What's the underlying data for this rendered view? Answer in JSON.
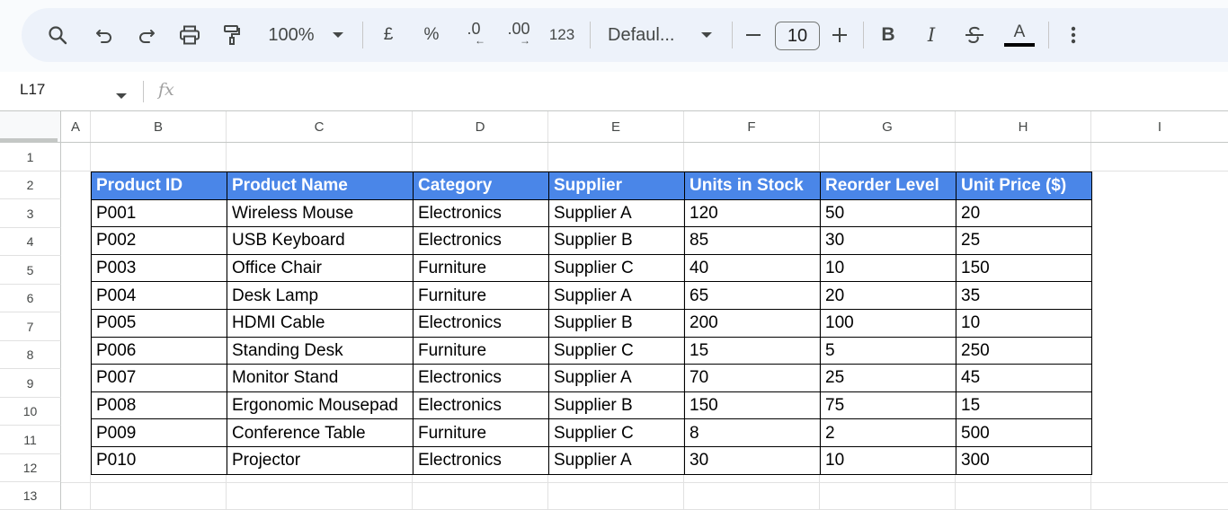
{
  "toolbar": {
    "zoom": "100%",
    "currency": "£",
    "percent": "%",
    "decimal_decrease": ".0",
    "decimal_increase": ".00",
    "number_format": "123",
    "font": "Defaul...",
    "font_size": "10",
    "bold": "B",
    "italic": "I",
    "text_color": "A",
    "icons": [
      "search-icon",
      "undo-icon",
      "redo-icon",
      "print-icon",
      "paint-format-icon",
      "dropdown-icon",
      "minus-icon",
      "plus-icon",
      "strikethrough-icon",
      "more-vert-icon"
    ]
  },
  "formula_bar": {
    "cell_ref": "L17",
    "fx": "fx",
    "formula": ""
  },
  "columns": [
    "A",
    "B",
    "C",
    "D",
    "E",
    "F",
    "G",
    "H",
    "I"
  ],
  "rows": [
    "1",
    "2",
    "3",
    "4",
    "5",
    "6",
    "7",
    "8",
    "9",
    "10",
    "11",
    "12",
    "13"
  ],
  "table": {
    "headers": [
      "Product ID",
      "Product Name",
      "Category",
      "Supplier",
      "Units in Stock",
      "Reorder Level",
      "Unit Price ($)"
    ],
    "rows": [
      [
        "P001",
        "Wireless Mouse",
        "Electronics",
        "Supplier A",
        "120",
        "50",
        "20"
      ],
      [
        "P002",
        "USB Keyboard",
        "Electronics",
        "Supplier B",
        "85",
        "30",
        "25"
      ],
      [
        "P003",
        "Office Chair",
        "Furniture",
        "Supplier C",
        "40",
        "10",
        "150"
      ],
      [
        "P004",
        "Desk Lamp",
        "Furniture",
        "Supplier A",
        "65",
        "20",
        "35"
      ],
      [
        "P005",
        "HDMI Cable",
        "Electronics",
        "Supplier B",
        "200",
        "100",
        "10"
      ],
      [
        "P006",
        "Standing Desk",
        "Furniture",
        "Supplier C",
        "15",
        "5",
        "250"
      ],
      [
        "P007",
        "Monitor Stand",
        "Electronics",
        "Supplier A",
        "70",
        "25",
        "45"
      ],
      [
        "P008",
        "Ergonomic Mousepad",
        "Electronics",
        "Supplier B",
        "150",
        "75",
        "15"
      ],
      [
        "P009",
        "Conference Table",
        "Furniture",
        "Supplier C",
        "8",
        "2",
        "500"
      ],
      [
        "P010",
        "Projector",
        "Electronics",
        "Supplier A",
        "30",
        "10",
        "300"
      ]
    ]
  },
  "colors": {
    "header_fill": "#4a86e8",
    "header_text": "#ffffff",
    "toolbar_bg": "#edf2fa"
  }
}
